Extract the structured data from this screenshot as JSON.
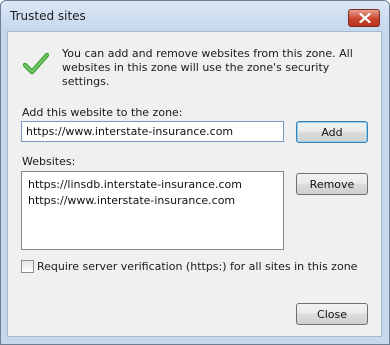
{
  "window": {
    "title": "Trusted sites"
  },
  "info_text": "You can add and remove websites from this zone. All websites in this zone will use the zone's security settings.",
  "add_section": {
    "label": "Add this website to the zone:",
    "input_value": "https://www.interstate-insurance.com",
    "add_button": "Add"
  },
  "websites": {
    "label": "Websites:",
    "items": [
      "https://linsdb.interstate-insurance.com",
      "https://www.interstate-insurance.com"
    ],
    "remove_button": "Remove"
  },
  "https_check": {
    "label": "Require server verification (https:) for all sites in this zone",
    "checked": false
  },
  "close_button": "Close",
  "icons": {
    "info": "checkmark-icon",
    "title_close": "close-icon"
  },
  "colors": {
    "checkmark": "#3fa33c",
    "close_button_red": "#c9452e"
  }
}
